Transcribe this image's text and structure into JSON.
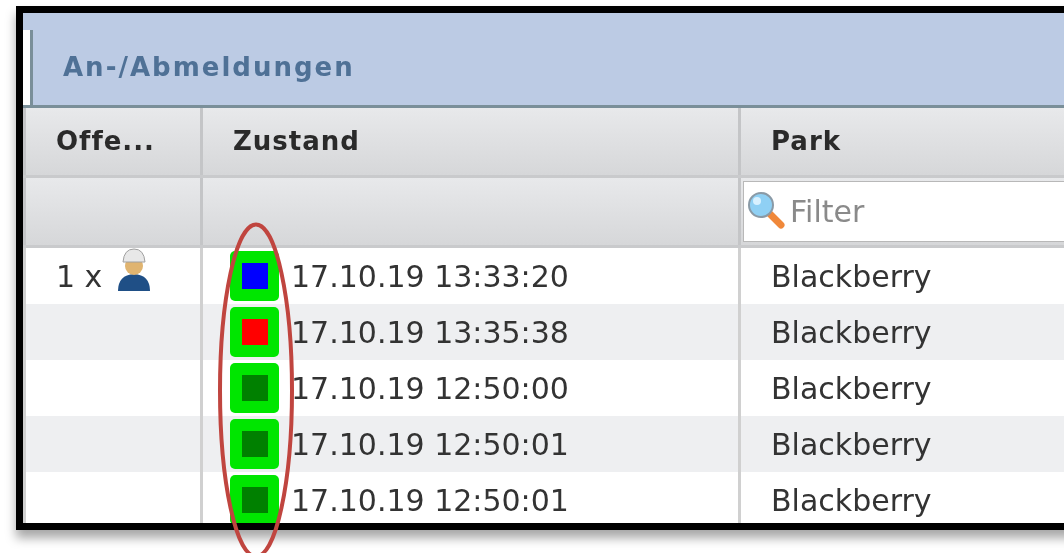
{
  "panel": {
    "title": "An-/Abmeldungen"
  },
  "table": {
    "columns": [
      "Offe...",
      "Zustand",
      "Park"
    ],
    "filter": {
      "placeholder": "Filter"
    },
    "rows": [
      {
        "offen": "1 x",
        "has_person": true,
        "color": "#0000ff",
        "zustand": "17.10.19 13:33:20",
        "park": "Blackberry"
      },
      {
        "color": "#ff0000",
        "zustand": "17.10.19 13:35:38",
        "park": "Blackberry"
      },
      {
        "color": "#008000",
        "zustand": "17.10.19 12:50:00",
        "park": "Blackberry"
      },
      {
        "color": "#008000",
        "zustand": "17.10.19 12:50:01",
        "park": "Blackberry"
      },
      {
        "color": "#008000",
        "zustand": "17.10.19 12:50:01",
        "park": "Blackberry"
      }
    ]
  }
}
